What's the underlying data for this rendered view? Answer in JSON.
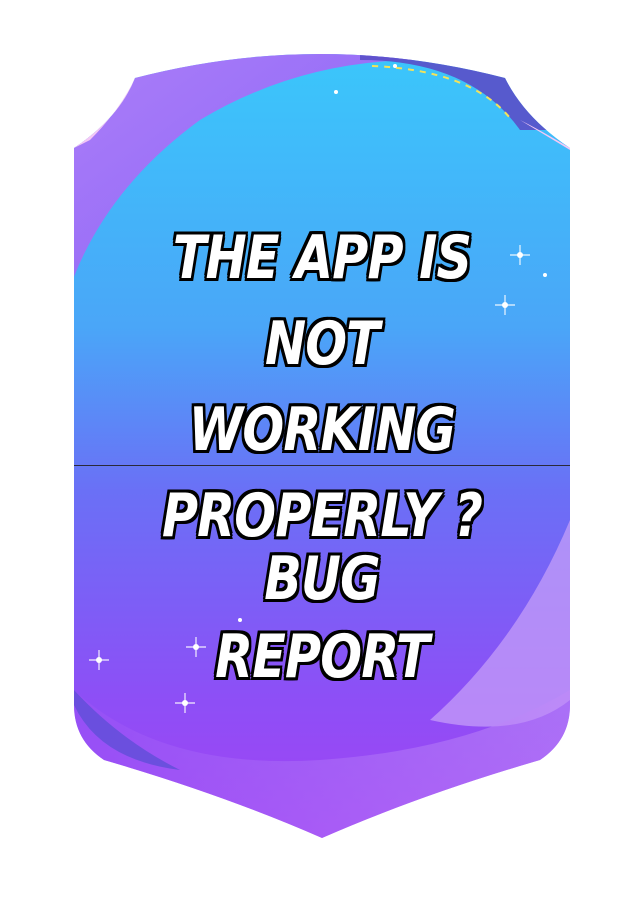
{
  "card": {
    "question_line1": "THE APP IS NOT",
    "question_line2": "WORKING",
    "question_line3": "PROPERLY ?",
    "cta_line1": "BUG",
    "cta_line2": "REPORT"
  },
  "colors": {
    "top_gradient": "#35c6fb",
    "mid_gradient": "#6f6cf7",
    "bottom_gradient": "#a53cf5",
    "accent_swirl": "#c58cf9",
    "pink_edge": "#f4c8f5",
    "dashed_line": "#f3e35a"
  }
}
